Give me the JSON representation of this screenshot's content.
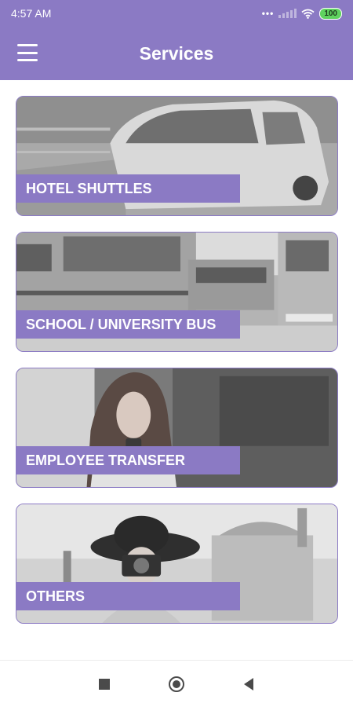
{
  "status_bar": {
    "time": "4:57 AM",
    "battery": "100",
    "icons": [
      "more-dots-icon",
      "signal-icon",
      "wifi-icon",
      "battery-icon"
    ]
  },
  "app_bar": {
    "title": "Services",
    "menu_icon": "hamburger-menu-icon"
  },
  "services": [
    {
      "label": "HOTEL SHUTTLES",
      "image": "shuttle-van-photo"
    },
    {
      "label": "SCHOOL / UNIVERSITY BUS",
      "image": "school-bus-photo"
    },
    {
      "label": "EMPLOYEE TRANSFER",
      "image": "woman-with-phone-photo"
    },
    {
      "label": "OTHERS",
      "image": "tourist-with-camera-photo"
    }
  ],
  "nav_bar": {
    "icons": [
      "recents-square-icon",
      "home-circle-icon",
      "back-triangle-icon"
    ]
  },
  "colors": {
    "primary": "#8b7ac4",
    "battery": "#5fd35f"
  }
}
